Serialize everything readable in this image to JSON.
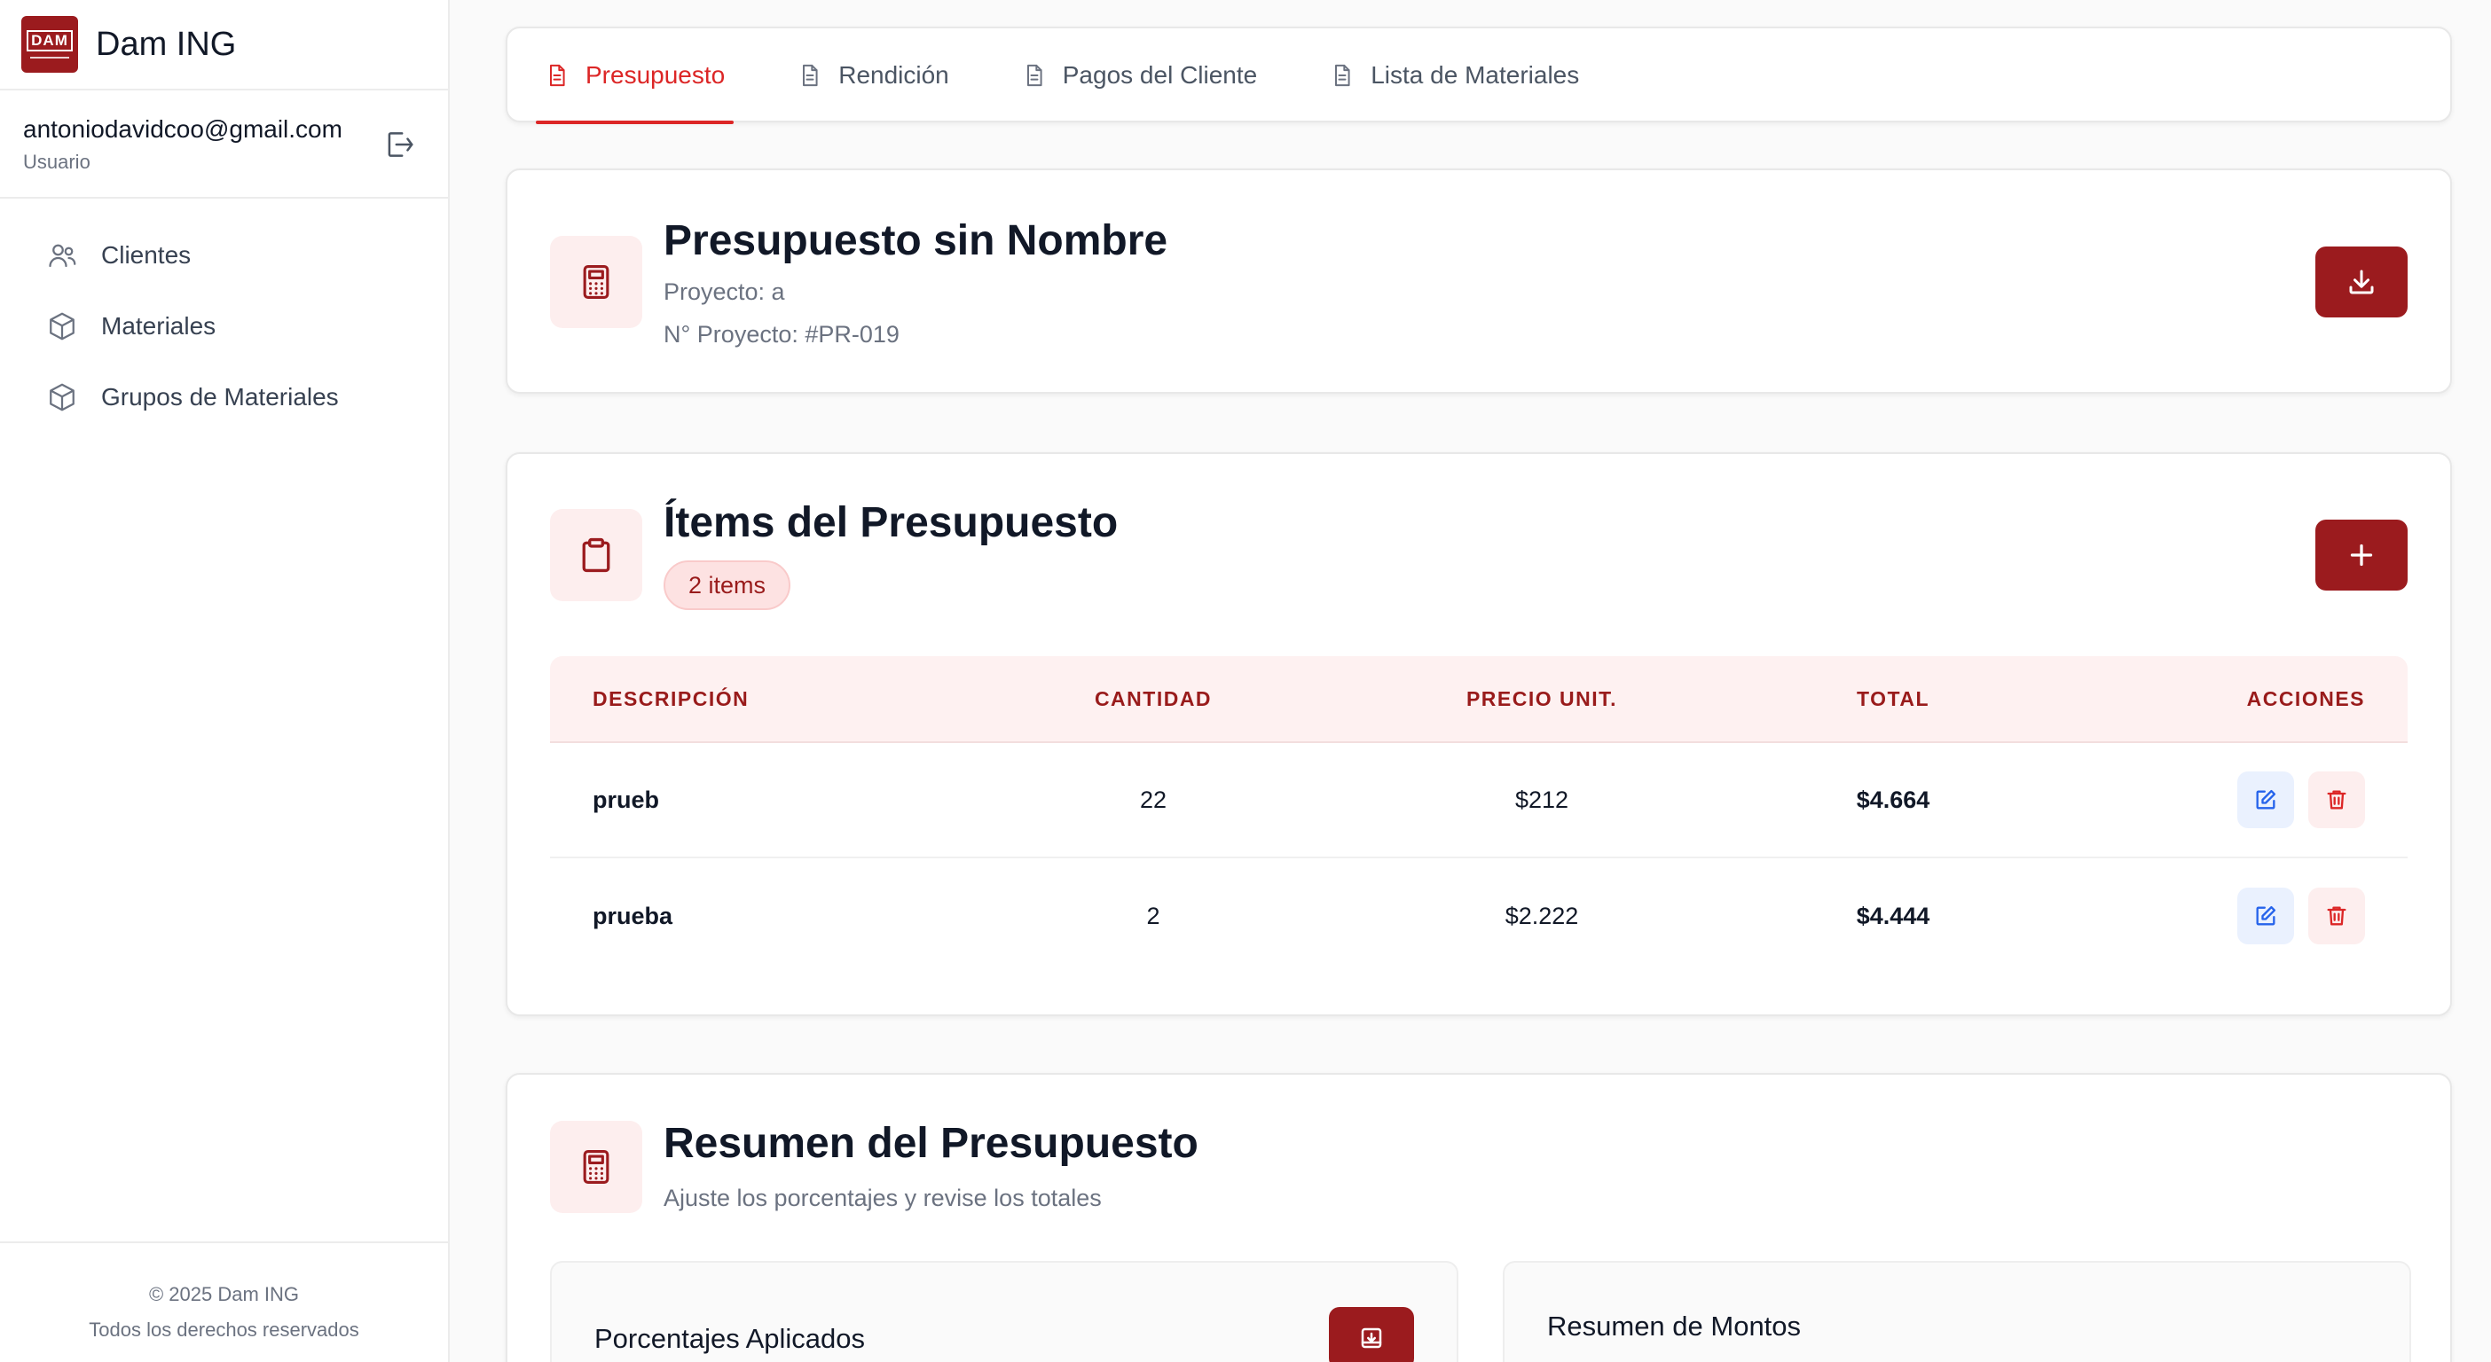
{
  "app": {
    "brand": "Dam ING",
    "logo_text": "DAM"
  },
  "user": {
    "email": "antoniodavidcoo@gmail.com",
    "role": "Usuario"
  },
  "sidebar": {
    "items": [
      {
        "label": "Clientes",
        "icon": "users-icon"
      },
      {
        "label": "Materiales",
        "icon": "box-icon"
      },
      {
        "label": "Grupos de Materiales",
        "icon": "box-icon"
      }
    ]
  },
  "footer": {
    "copyright": "© 2025 Dam ING",
    "rights": "Todos los derechos reservados"
  },
  "tabs": [
    {
      "label": "Presupuesto",
      "active": true
    },
    {
      "label": "Rendición",
      "active": false
    },
    {
      "label": "Pagos del Cliente",
      "active": false
    },
    {
      "label": "Lista de Materiales",
      "active": false
    }
  ],
  "budget": {
    "title": "Presupuesto sin Nombre",
    "project": "Proyecto: a",
    "project_number": "N° Proyecto: #PR-019"
  },
  "items_section": {
    "title": "Ítems del Presupuesto",
    "count_badge": "2 items",
    "columns": {
      "description": "DESCRIPCIÓN",
      "quantity": "CANTIDAD",
      "unit_price": "PRECIO UNIT.",
      "total": "TOTAL",
      "actions": "ACCIONES"
    },
    "rows": [
      {
        "description": "prueb",
        "quantity": "22",
        "unit_price": "$212",
        "total": "$4.664"
      },
      {
        "description": "prueba",
        "quantity": "2",
        "unit_price": "$2.222",
        "total": "$4.444"
      }
    ]
  },
  "summary": {
    "title": "Resumen del Presupuesto",
    "subtitle": "Ajuste los porcentajes y revise los totales",
    "percentages_title": "Porcentajes Aplicados",
    "amounts_title": "Resumen de Montos"
  },
  "colors": {
    "accent": "#9b1b1e",
    "active_tab": "#dc2626",
    "icon_tile_bg": "#fdeeee",
    "edit_blue": "#2563eb",
    "delete_red": "#dc2626"
  }
}
